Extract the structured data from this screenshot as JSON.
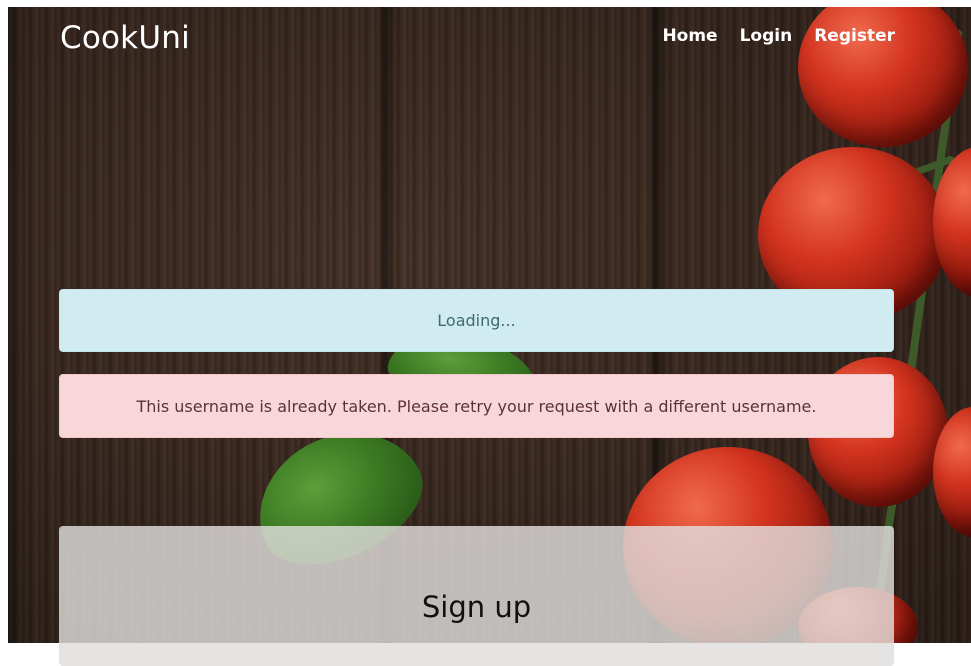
{
  "navbar": {
    "brand": "CookUni",
    "links": [
      "Home",
      "Login",
      "Register"
    ]
  },
  "alerts": {
    "info": "Loading...",
    "error": "This username is already taken. Please retry your request with a different username."
  },
  "signup": {
    "title": "Sign up"
  },
  "colors": {
    "info_bg": "#d1ecf1",
    "error_bg": "#f8d7da",
    "nav_text": "#ffffff"
  }
}
